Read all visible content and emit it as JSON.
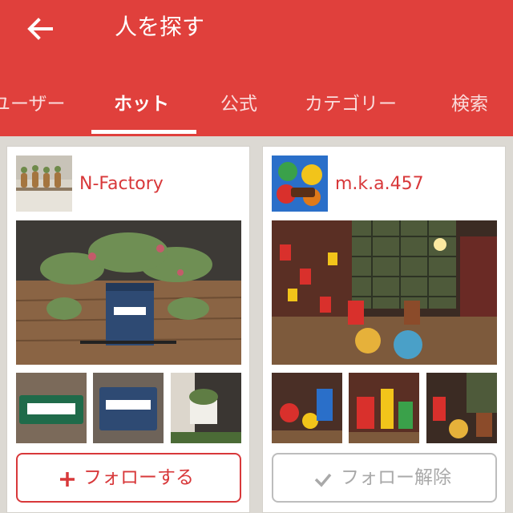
{
  "header": {
    "title": "人を探す",
    "back_icon": "arrow-left-icon",
    "background_color": "#e0403c"
  },
  "tabs": [
    {
      "label": "ユーザー",
      "active": false
    },
    {
      "label": "ホット",
      "active": true
    },
    {
      "label": "公式",
      "active": false
    },
    {
      "label": "カテゴリー",
      "active": false
    },
    {
      "label": "検索",
      "active": false
    }
  ],
  "users": [
    {
      "name": "N-Factory",
      "follow_label": "フォローする",
      "follow_icon": "plus-icon",
      "following": false
    },
    {
      "name": "m.k.a.457",
      "follow_label": "フォロー解除",
      "follow_icon": "check-icon",
      "following": true
    }
  ],
  "colors": {
    "accent": "#d8383a",
    "muted": "#a9a9a9"
  }
}
